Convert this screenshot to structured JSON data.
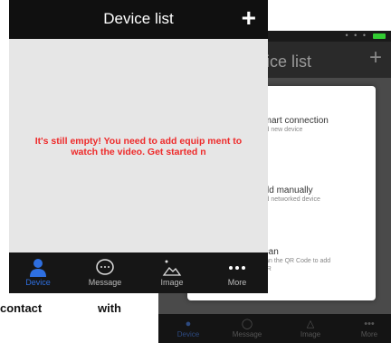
{
  "front": {
    "title": "Device list",
    "add_label": "+",
    "empty_message": "It's still empty! You need to add equip ment to watch the video. Get started n",
    "tabs": [
      {
        "label": "Device",
        "icon": "person-icon"
      },
      {
        "label": "Message",
        "icon": "message-icon"
      },
      {
        "label": "Image",
        "icon": "image-icon"
      },
      {
        "label": "More",
        "icon": "more-icon"
      }
    ],
    "accent_color": "#2e6fe0",
    "message_color": "#ee2a2a"
  },
  "back": {
    "title": "vice list",
    "add_label": "+",
    "tabs": [
      {
        "label": "Device"
      },
      {
        "label": "Message"
      },
      {
        "label": "Image"
      },
      {
        "label": "More"
      }
    ]
  },
  "popup": {
    "items": [
      {
        "title": "Smart connection",
        "subtitle": "Add new device"
      },
      {
        "title": "Add manually",
        "subtitle": "Add networked device"
      },
      {
        "title": "Scan",
        "subtitle": "Scan the QR Code to add NVR"
      }
    ]
  },
  "document_text": {
    "word1": "contact",
    "word2": "with"
  }
}
